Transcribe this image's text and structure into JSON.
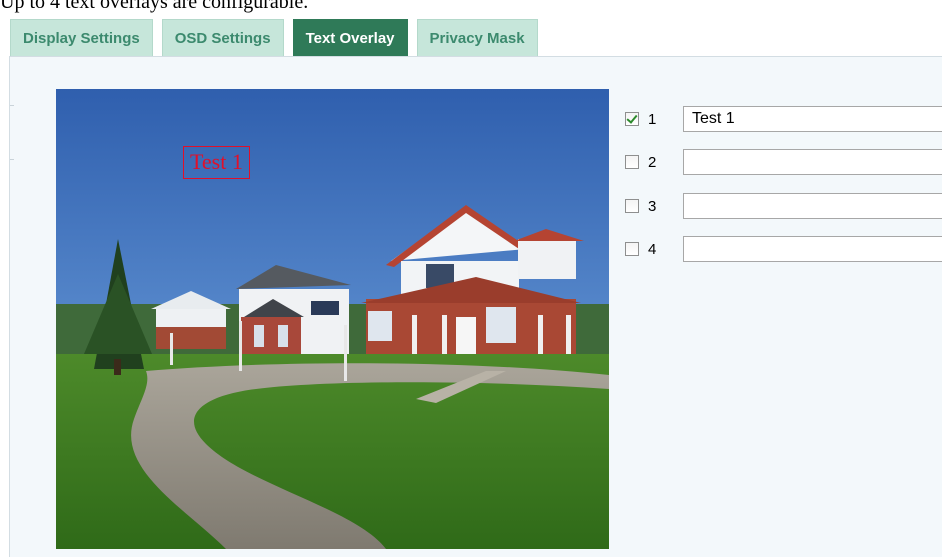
{
  "caption": "Up to 4 text overlays are configurable.",
  "tabs": [
    {
      "label": "Display Settings",
      "active": false
    },
    {
      "label": "OSD Settings",
      "active": false
    },
    {
      "label": "Text Overlay",
      "active": true
    },
    {
      "label": "Privacy Mask",
      "active": false
    }
  ],
  "preview": {
    "overlay_text": "Test 1"
  },
  "overlays": [
    {
      "number": "1",
      "checked": true,
      "value": "Test 1"
    },
    {
      "number": "2",
      "checked": false,
      "value": ""
    },
    {
      "number": "3",
      "checked": false,
      "value": ""
    },
    {
      "number": "4",
      "checked": false,
      "value": ""
    }
  ],
  "colors": {
    "tab_active_bg": "#2f7a58",
    "tab_inactive_bg": "#c6e6da",
    "tab_inactive_text": "#3c8a6e",
    "overlay_text_color": "#e0102a",
    "panel_bg": "#f3f8fb"
  }
}
